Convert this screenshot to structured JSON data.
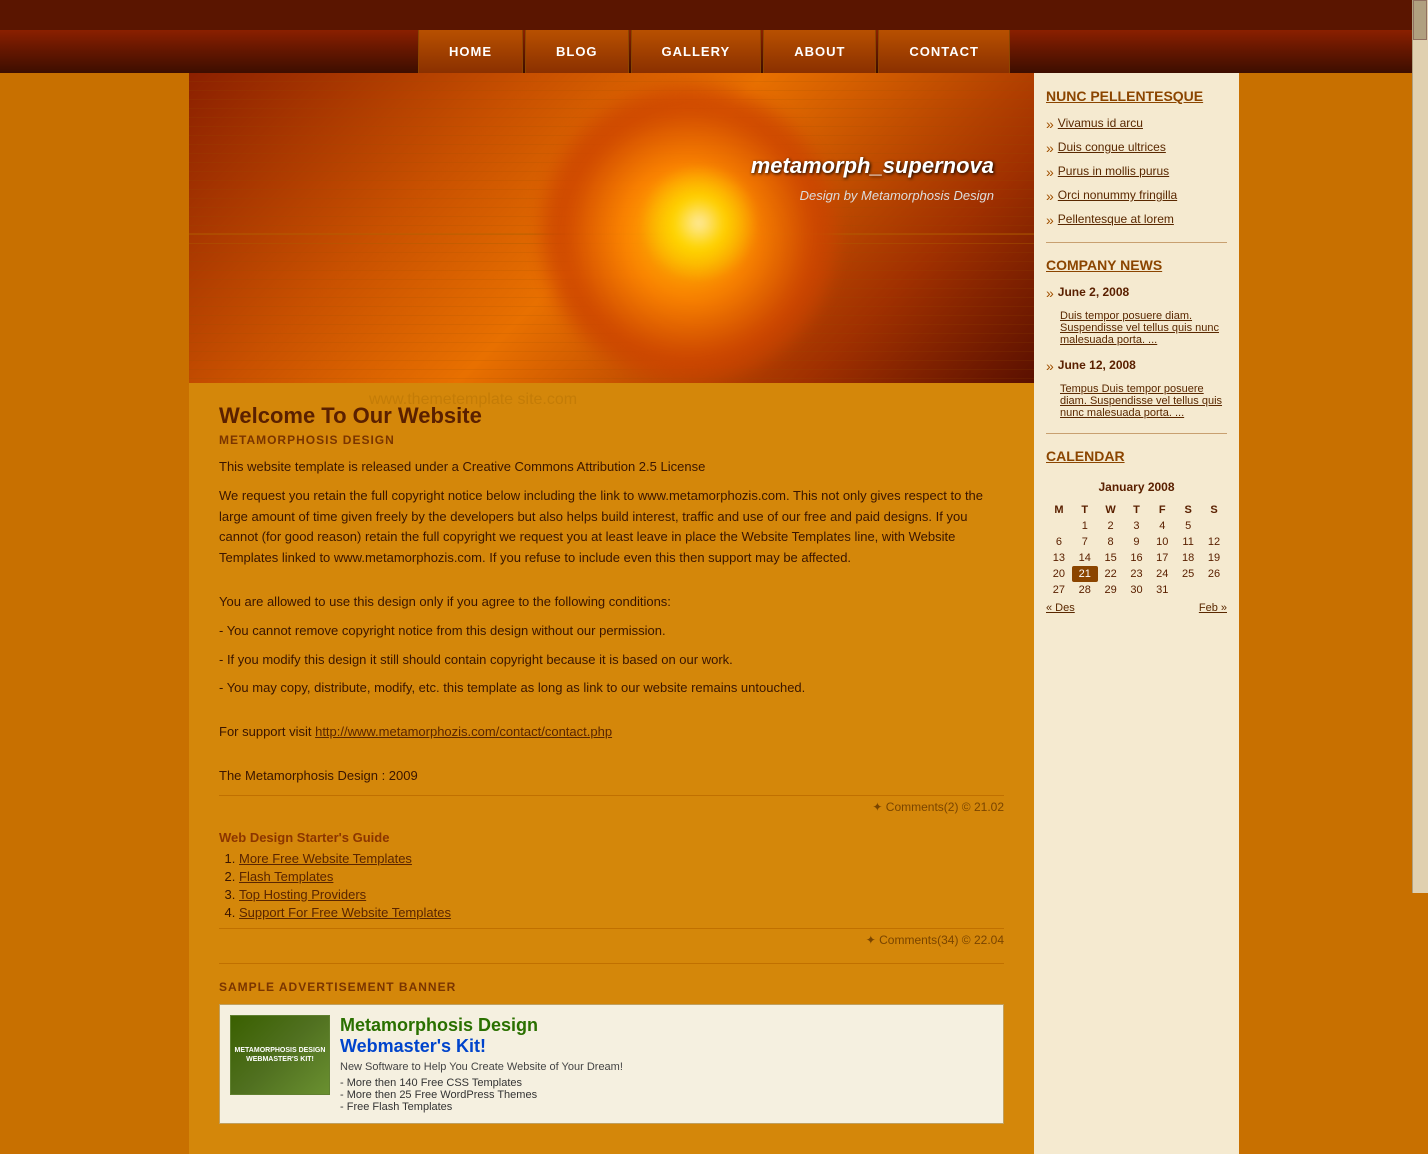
{
  "nav": {
    "items": [
      {
        "label": "HOME",
        "id": "home"
      },
      {
        "label": "BLOG",
        "id": "blog"
      },
      {
        "label": "GALLERY",
        "id": "gallery"
      },
      {
        "label": "ABOUT",
        "id": "about"
      },
      {
        "label": "CONTACT",
        "id": "contact"
      }
    ]
  },
  "banner": {
    "site_name": "metamorph_supernova",
    "design_by": "Design by Metamorphosis Design",
    "watermark": "www.themetemplate site.com"
  },
  "post1": {
    "title": "Welcome To Our Website",
    "subtitle": "METAMORPHOSIS DESIGN",
    "body1": "This website template is released under a Creative Commons Attribution 2.5 License",
    "body2": "We request you retain the full copyright notice below including the link to www.metamorphozis.com. This not only gives respect to the large amount of time given freely by the developers but also helps build interest, traffic and use of our free and paid designs. If you cannot (for good reason) retain the full copyright we request you at least leave in place the Website Templates line, with Website Templates linked to www.metamorphozis.com. If you refuse to include even this then support may be affected.",
    "body3": "You are allowed to use this design only if you agree to the following conditions:",
    "condition1": "- You cannot remove copyright notice from this design without our permission.",
    "condition2": "- If you modify this design it still should contain copyright because it is based on our work.",
    "condition3": "- You may copy, distribute, modify, etc. this template as long as link to our website remains untouched.",
    "support_text": "For support visit",
    "support_link": "http://www.metamorphozis.com/contact/contact.php",
    "footer_text": "The Metamorphosis Design : 2009",
    "meta": "✦ Comments(2) © 21.02"
  },
  "post2": {
    "title": "Web Design Starter's Guide",
    "items": [
      {
        "num": "1.",
        "text": "More Free Website Templates"
      },
      {
        "num": "2.",
        "text": "Flash Templates"
      },
      {
        "num": "3.",
        "text": "Top Hosting Providers"
      },
      {
        "num": "4.",
        "text": "Support For Free Website Templates"
      }
    ],
    "meta": "✦ Comments(34) © 22.04"
  },
  "ad": {
    "section_title": "SAMPLE ADVERTISEMENT BANNER",
    "img_line1": "METAMORPHOSIS DESIGN",
    "img_line2": "WEBMASTER'S KIT!",
    "title_line1": "Metamorphosis Design",
    "title_line2": "Webmaster's Kit!",
    "subtitle": "New Software to Help You Create Website of Your Dream!",
    "bullet1": "More then 140 Free CSS Templates",
    "bullet2": "More then 25 Free WordPress Themes",
    "bullet3": "Free Flash Templates"
  },
  "sidebar": {
    "section1_title": "NUNC PELLENTESQUE",
    "links": [
      "Vivamus id arcu",
      "Duis congue ultrices",
      "Purus in mollis purus",
      "Orci nonummy fringilla",
      "Pellentesque at lorem"
    ],
    "section2_title": "COMPANY NEWS",
    "news": [
      {
        "date": "June 2, 2008",
        "text": "Duis tempor posuere diam. Suspendisse vel tellus quis nunc malesuada porta. ..."
      },
      {
        "date": "June 12, 2008",
        "text": "Tempus Duis tempor posuere diam. Suspendisse vel tellus quis nunc malesuada porta. ..."
      }
    ],
    "calendar_title": "CALENDAR",
    "calendar_month": "January 2008",
    "calendar_headers": [
      "M",
      "T",
      "W",
      "T",
      "F",
      "S",
      "S"
    ],
    "calendar_rows": [
      [
        "",
        "1",
        "2",
        "3",
        "4",
        "5"
      ],
      [
        "6",
        "7",
        "8",
        "9",
        "10",
        "11",
        "12"
      ],
      [
        "13",
        "14",
        "15",
        "16",
        "17",
        "18",
        "19"
      ],
      [
        "20",
        "21",
        "22",
        "23",
        "24",
        "25",
        "26"
      ],
      [
        "27",
        "28",
        "29",
        "30",
        "31",
        "",
        ""
      ]
    ],
    "today": "21",
    "cal_prev": "« Des",
    "cal_next": "Feb »"
  }
}
